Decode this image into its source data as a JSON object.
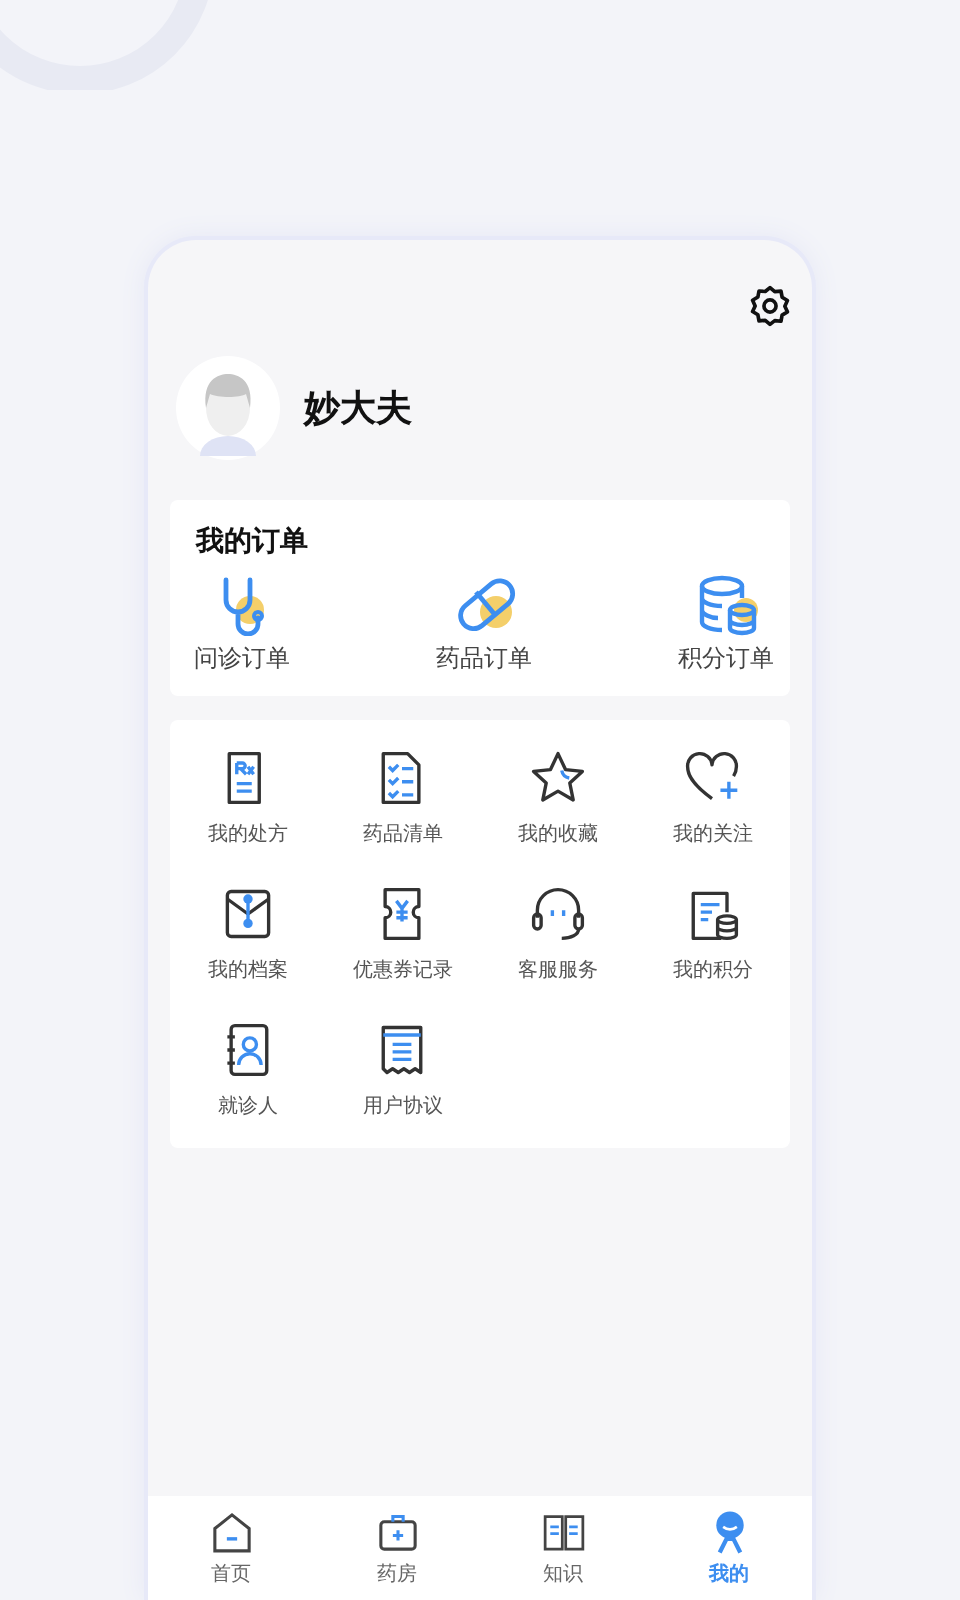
{
  "profile": {
    "name": "妙大夫"
  },
  "orders": {
    "title": "我的订单",
    "items": [
      {
        "label": "问诊订单"
      },
      {
        "label": "药品订单"
      },
      {
        "label": "积分订单"
      }
    ]
  },
  "services": [
    {
      "label": "我的处方"
    },
    {
      "label": "药品清单"
    },
    {
      "label": "我的收藏"
    },
    {
      "label": "我的关注"
    },
    {
      "label": "我的档案"
    },
    {
      "label": "优惠券记录"
    },
    {
      "label": "客服服务"
    },
    {
      "label": "我的积分"
    },
    {
      "label": "就诊人"
    },
    {
      "label": "用户协议"
    }
  ],
  "tabs": [
    {
      "label": "首页",
      "selected": false
    },
    {
      "label": "药房",
      "selected": false
    },
    {
      "label": "知识",
      "selected": false
    },
    {
      "label": "我的",
      "selected": true
    }
  ]
}
